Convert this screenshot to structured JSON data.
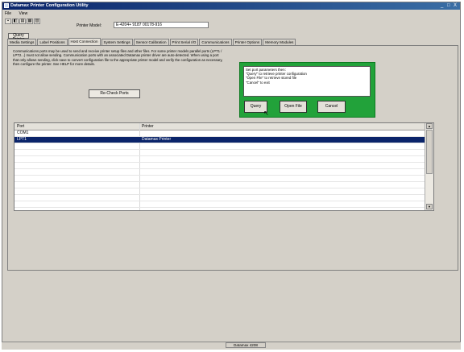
{
  "window": {
    "title": "Datamax Printer Configuration Utility",
    "controls": [
      "_",
      "□",
      "X"
    ]
  },
  "menu": [
    "File",
    "View"
  ],
  "toolbar": {
    "icons": [
      "save-icon",
      "open-icon",
      "send-icon",
      "print-icon",
      "settings-icon"
    ]
  },
  "printer_model": {
    "label": "Printer Model:",
    "value": "E-4204+ 9187 00178-916"
  },
  "query_button": "Query Printer",
  "tabs": [
    "Media Settings",
    "Label Positions",
    "Host Connection",
    "System Settings",
    "Sensor Calibration",
    "Print Serial I/O",
    "Communications",
    "Printer Options",
    "Memory Modules"
  ],
  "active_tab": "Host Connection",
  "description": "Communications ports may be used to send and receive printer setup files and other files. For some printer models parallel ports (LPT1 / LPT2...) must not allow sending. Communication ports with an associated Datamax printer driver are auto-detected. When using a port that only allows sending, click save to convert configuration file to the appropriate printer model and verify the configuration as necessary, then configure the printer. See HELP for more details.",
  "recheck_button": "Re-Check Ports",
  "dialog": {
    "message_lines": [
      "Set port parameters then:",
      "\"Query\" to retrieve printer configuration",
      "\"Open File\" to retrieve stored file",
      "\"Cancel\" to exit"
    ],
    "buttons": [
      "Query",
      "Open File",
      "Cancel"
    ]
  },
  "ports_table": {
    "columns": [
      "Port",
      "Printer"
    ],
    "rows": [
      [
        "COM1",
        ""
      ],
      [
        "LPT1",
        "Datamax Printer"
      ]
    ],
    "selected_row": 1
  },
  "status": "Datamax 4208"
}
